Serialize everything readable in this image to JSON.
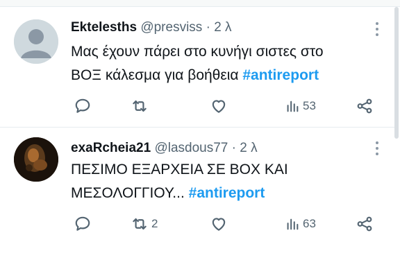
{
  "tweets": [
    {
      "display_name": "Ektelesths",
      "handle": "@presviss",
      "separator": "·",
      "time": "2 λ",
      "text_line1": "Μας έχουν πάρει στο κυνήγι σιστες στο",
      "text_line2": "ΒΟΞ κάλεσμα για βοήθεια",
      "hashtag": "#antireport",
      "reply_count": "",
      "retweet_count": "",
      "like_count": "",
      "views_count": "53",
      "avatar": "default-avatar-icon"
    },
    {
      "display_name": "exaRcheia21",
      "handle": "@lasdous77",
      "separator": "·",
      "time": "2 λ",
      "text_line1": "ΠΕΣΙΜΟ ΕΞΑΡΧΕΙΑ ΣΕ ΒΟΧ ΚΑΙ",
      "text_line2": "ΜΕΣΟΛΟΓΓΙΟΥ...",
      "hashtag": "#antireport",
      "reply_count": "",
      "retweet_count": "2",
      "like_count": "",
      "views_count": "63",
      "avatar": "photo-avatar"
    }
  ],
  "colors": {
    "hashtag": "#1d9bf0",
    "secondary_text": "#536471",
    "primary_text": "#0f1419",
    "divider": "#e6ecf0"
  },
  "icons": [
    "reply-icon",
    "retweet-icon",
    "like-icon",
    "views-icon",
    "share-icon",
    "more-icon"
  ]
}
